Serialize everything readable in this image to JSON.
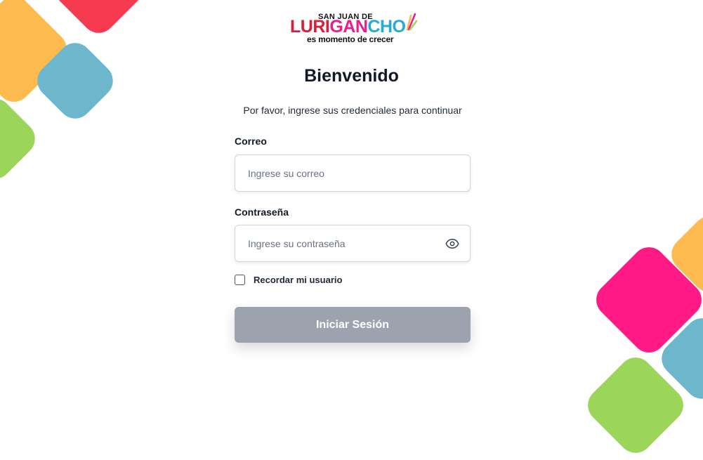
{
  "brand": {
    "line1": "SAN JUAN DE",
    "name_parts": [
      {
        "text": "LURI",
        "color": "#D6203C"
      },
      {
        "text": "GAN",
        "color": "#EC1C8C"
      },
      {
        "text": "CHO",
        "color": "#27A9D9"
      }
    ],
    "tagline": "es momento de crecer",
    "mark_colors": [
      "#FDBB4F",
      "#EC1C8C",
      "#9BD55A"
    ]
  },
  "login": {
    "title": "Bienvenido",
    "subtitle": "Por favor, ingrese sus credenciales para continuar",
    "email": {
      "label": "Correo",
      "placeholder": "Ingrese su correo",
      "value": ""
    },
    "password": {
      "label": "Contraseña",
      "placeholder": "Ingrese su contraseña",
      "value": "",
      "toggle_icon": "eye-icon"
    },
    "remember": {
      "label": "Recordar mi usuario",
      "checked": false
    },
    "submit_label": "Iniciar Sesión"
  },
  "decor_colors": [
    "#FDBB4F",
    "#F5394E",
    "#6CB7CC",
    "#9BD55A",
    "#FF1A86"
  ]
}
